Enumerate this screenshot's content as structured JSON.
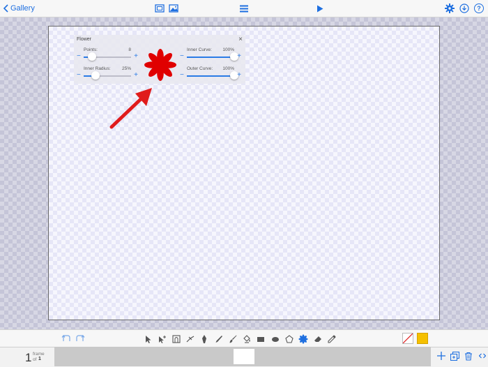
{
  "topbar": {
    "back_label": "Gallery",
    "icons": [
      "chevron-left-icon",
      "frame-mode-icon",
      "image-mode-icon",
      "menu-icon",
      "play-icon",
      "gear-icon",
      "download-icon",
      "help-icon"
    ],
    "help_glyph": "?"
  },
  "accent_color": "#1e6fe0",
  "flower_panel": {
    "title": "Flower",
    "close_glyph": "×",
    "params": [
      {
        "label": "Points:",
        "value": "8",
        "fraction": 0.18
      },
      {
        "label": "Inner Radius:",
        "value": "25%",
        "fraction": 0.25
      },
      {
        "label": "Inner Curve:",
        "value": "100%",
        "fraction": 1.0
      },
      {
        "label": "Outer Curve:",
        "value": "100%",
        "fraction": 1.0
      }
    ],
    "minus_glyph": "−",
    "plus_glyph": "+",
    "preview_color": "#e00000",
    "preview_petals": 8
  },
  "annotation_arrow_color": "#e01b1b",
  "toolbar": {
    "tools": [
      "select",
      "subselect",
      "mask",
      "knife",
      "pen",
      "pencil",
      "brush",
      "paint-bucket",
      "rectangle",
      "ellipse",
      "polygon",
      "flower",
      "eraser",
      "eyedropper"
    ],
    "active_tool": "flower",
    "stroke_color": "none",
    "fill_color": "#f5c000"
  },
  "timeline": {
    "current_frame": "1",
    "frame_word": "frame",
    "of_word": "of",
    "total_frames": "1"
  }
}
